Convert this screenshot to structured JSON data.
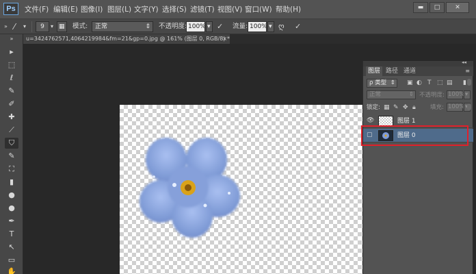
{
  "app": {
    "logo": "Ps",
    "menu": [
      "文件(F)",
      "编辑(E)",
      "图像(I)",
      "图层(L)",
      "文字(Y)",
      "选择(S)",
      "滤镜(T)",
      "视图(V)",
      "窗口(W)",
      "帮助(H)"
    ],
    "window_buttons": [
      "▬",
      "□",
      "✕"
    ]
  },
  "options_bar": {
    "brush_size": "9",
    "mode_label": "模式:",
    "mode_value": "正常",
    "opacity_label": "不透明度:",
    "opacity_value": "100%",
    "flow_label": "流量:",
    "flow_value": "100%"
  },
  "document": {
    "tab_title": "u=3424762571,4064219984&fm=21&gp=0.jpg @ 161% (图层 0, RGB/8) *",
    "tab_close": "×"
  },
  "tools": [
    "▸",
    "⬚",
    "ℓ",
    "✎",
    "✐",
    "✚",
    "⟋",
    "⛉",
    "✎",
    "⛶",
    "▮",
    "●",
    "●",
    "✒",
    "T",
    "↖",
    "▭",
    "✋"
  ],
  "layers_panel": {
    "tabs": [
      "图层",
      "路径",
      "通道"
    ],
    "filter_label": "ρ 类型",
    "blend_mode": "正常",
    "opacity_label": "不透明度:",
    "opacity_value": "100%",
    "lock_label": "锁定:",
    "fill_label": "填充:",
    "fill_value": "100%",
    "layers": [
      {
        "name": "图层 1",
        "visible": true,
        "selected": false
      },
      {
        "name": "图层 0",
        "visible": false,
        "selected": true
      }
    ]
  },
  "colors": {
    "highlight_box": "#e0202a",
    "selected_layer": "#4f6b8b",
    "flower_petal": "#7f9bd6"
  }
}
